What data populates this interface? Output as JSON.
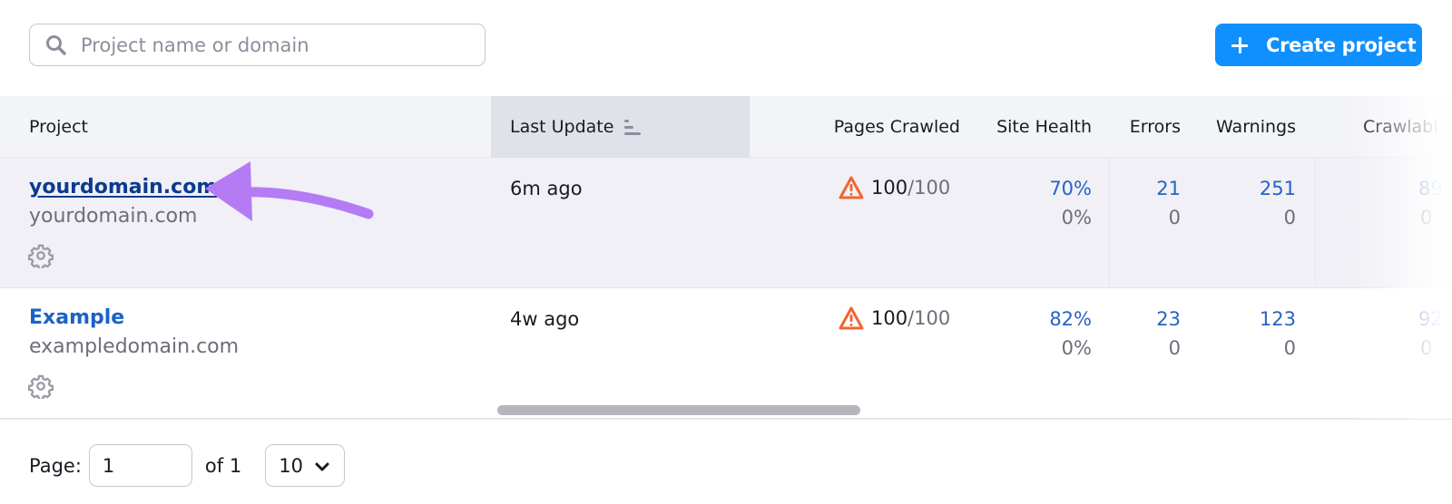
{
  "search": {
    "placeholder": "Project name or domain",
    "value": "",
    "icon": "search-icon"
  },
  "toolbar": {
    "create_label": "Create project",
    "create_icon": "plus-icon",
    "accent_color": "#1090ff"
  },
  "table": {
    "columns": [
      {
        "label": "Project"
      },
      {
        "label": "Last Update",
        "sorted": true,
        "sort_icon": "sort-icon"
      },
      {
        "label": "Pages Crawled"
      },
      {
        "label": "Site Health"
      },
      {
        "label": "Errors"
      },
      {
        "label": "Warnings"
      },
      {
        "label": "Crawlabi"
      }
    ],
    "rows": [
      {
        "name": "yourdomain.com",
        "domain": "yourdomain.com",
        "last_update": "6m ago",
        "pages_crawled": "100",
        "pages_total": "/100",
        "site_health": "70%",
        "site_health_change": "0%",
        "errors": "21",
        "errors_change": "0",
        "warnings": "251",
        "warnings_change": "0",
        "crawlability": "89",
        "crawlability_change": "0",
        "hovered": true
      },
      {
        "name": "Example",
        "domain": "exampledomain.com",
        "last_update": "4w ago",
        "pages_crawled": "100",
        "pages_total": "/100",
        "site_health": "82%",
        "site_health_change": "0%",
        "errors": "23",
        "errors_change": "0",
        "warnings": "123",
        "warnings_change": "0",
        "crawlability": "92",
        "crawlability_change": "0",
        "hovered": false
      }
    ]
  },
  "pagination": {
    "page_label": "Page:",
    "page_value": "1",
    "of_label": "of 1",
    "per_page": "10"
  },
  "colors": {
    "link": "#1a63c6",
    "link_visited": "#0b3b8c",
    "warning": "#f0652f",
    "annotation_arrow": "#b57bf5"
  }
}
